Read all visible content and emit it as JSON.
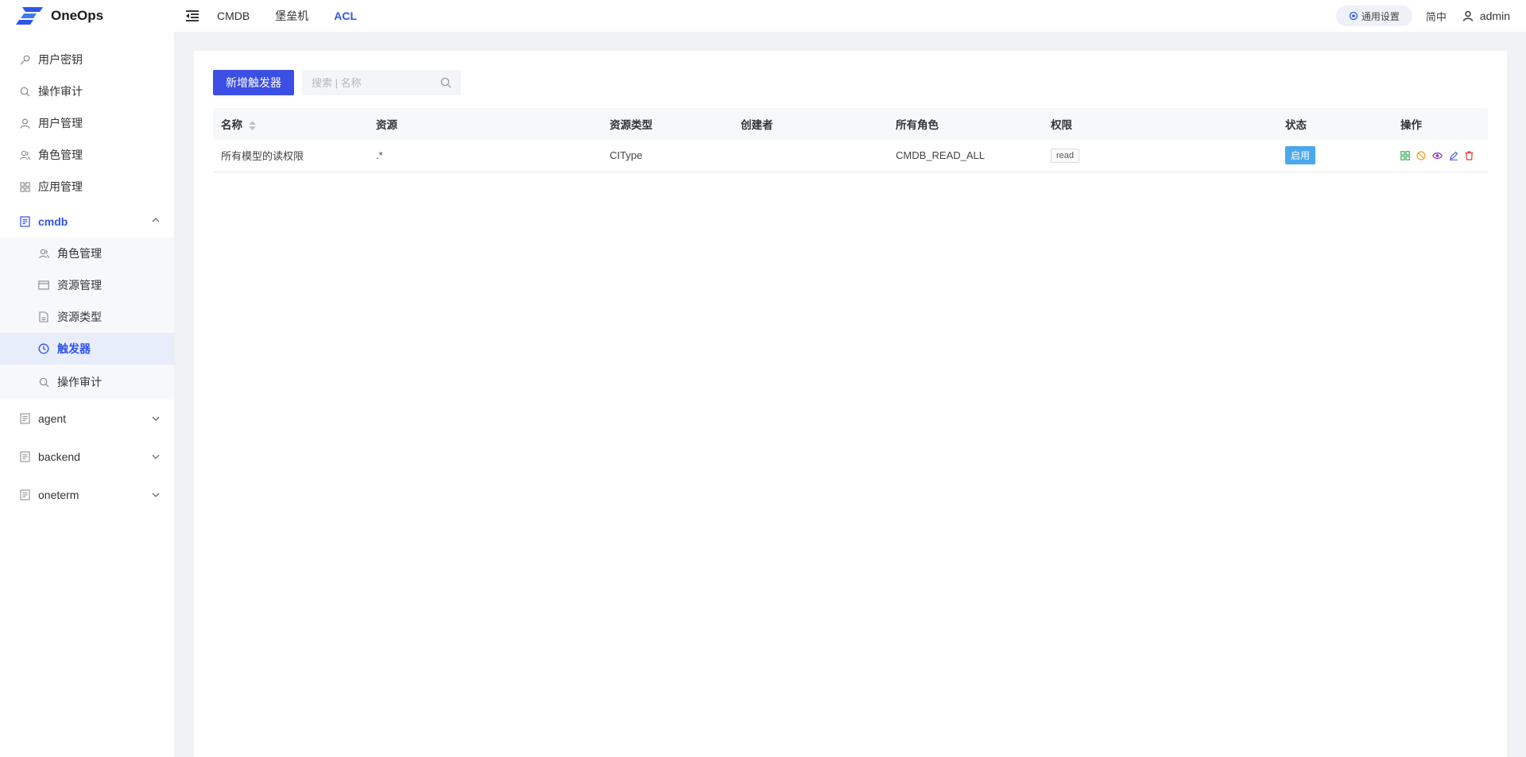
{
  "app": {
    "name": "OneOps"
  },
  "topnav": [
    {
      "label": "CMDB",
      "active": false
    },
    {
      "label": "堡垒机",
      "active": false
    },
    {
      "label": "ACL",
      "active": true
    }
  ],
  "topright": {
    "settings": "通用设置",
    "language": "简中",
    "user": "admin"
  },
  "sidebar": {
    "items": [
      {
        "label": "用户密钥",
        "icon": "key-icon"
      },
      {
        "label": "操作审计",
        "icon": "search-icon"
      },
      {
        "label": "用户管理",
        "icon": "user-icon"
      },
      {
        "label": "角色管理",
        "icon": "roles-icon"
      },
      {
        "label": "应用管理",
        "icon": "apps-icon"
      }
    ],
    "groups": [
      {
        "label": "cmdb",
        "open": true,
        "children": [
          {
            "label": "角色管理",
            "icon": "roles-icon"
          },
          {
            "label": "资源管理",
            "icon": "card-icon"
          },
          {
            "label": "资源类型",
            "icon": "file-icon"
          },
          {
            "label": "触发器",
            "icon": "clock-icon",
            "active": true
          },
          {
            "label": "操作审计",
            "icon": "search-icon"
          }
        ]
      },
      {
        "label": "agent",
        "open": false
      },
      {
        "label": "backend",
        "open": false
      },
      {
        "label": "oneterm",
        "open": false
      }
    ]
  },
  "toolbar": {
    "add_label": "新增触发器",
    "search_placeholder": "搜索 | 名称"
  },
  "table": {
    "headers": [
      "名称",
      "资源",
      "资源类型",
      "创建者",
      "所有角色",
      "权限",
      "状态",
      "操作"
    ],
    "rows": [
      {
        "name": "所有模型的读权限",
        "resource": ".*",
        "resource_type": "CIType",
        "creator": "",
        "roles": "CMDB_READ_ALL",
        "permission": "read",
        "status": "启用"
      }
    ]
  },
  "colors": {
    "accent": "#2f54eb",
    "primary_button": "#3b4fe4",
    "status_on": "#4aa8ec"
  }
}
